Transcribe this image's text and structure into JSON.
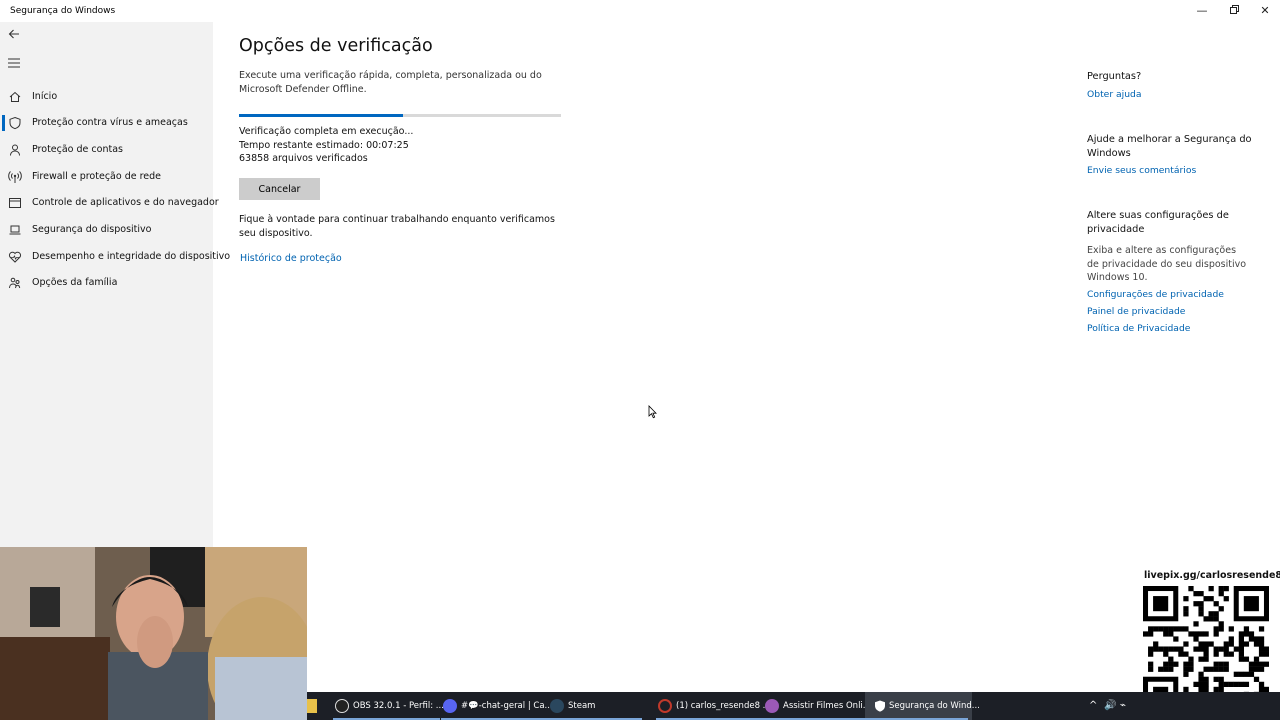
{
  "window": {
    "title": "Segurança do Windows"
  },
  "sidebar": {
    "items": [
      {
        "label": "Início",
        "icon": "home-icon"
      },
      {
        "label": "Proteção contra vírus e ameaças",
        "icon": "shield-icon"
      },
      {
        "label": "Proteção de contas",
        "icon": "person-icon"
      },
      {
        "label": "Firewall e proteção de rede",
        "icon": "antenna-icon"
      },
      {
        "label": "Controle de aplicativos e do navegador",
        "icon": "app-window-icon"
      },
      {
        "label": "Segurança do dispositivo",
        "icon": "laptop-icon"
      },
      {
        "label": "Desempenho e integridade do dispositivo",
        "icon": "heart-icon"
      },
      {
        "label": "Opções da família",
        "icon": "family-icon"
      }
    ]
  },
  "main": {
    "title": "Opções de verificação",
    "description": "Execute uma verificação rápida, completa, personalizada ou do Microsoft Defender Offline.",
    "progress_fraction": 0.51,
    "status_line1": "Verificação completa em execução...",
    "status_line2": "Tempo restante estimado: 00:07:25",
    "status_line3": "63858  arquivos verificados",
    "cancel_label": "Cancelar",
    "info_text": "Fique à vontade para continuar trabalhando enquanto verificamos seu dispositivo.",
    "history_link": "Histórico de proteção"
  },
  "right": {
    "questions_heading": "Perguntas?",
    "help_link": "Obter ajuda",
    "improve_heading": "Ajude a melhorar a Segurança do Windows",
    "feedback_link": "Envie seus comentários",
    "privacy_heading": "Altere suas configurações de privacidade",
    "privacy_text": "Exiba e altere as configurações de privacidade do seu dispositivo Windows 10.",
    "privacy_settings_link": "Configurações de privacidade",
    "privacy_panel_link": "Painel de privacidade",
    "privacy_policy_link": "Política de Privacidade"
  },
  "overlay": {
    "livepix": "livepix.gg/carlosresende8"
  },
  "taskbar": {
    "items": [
      {
        "label": "OBS 32.0.1 - Perfil: ...",
        "color": "#c0392b"
      },
      {
        "label": "#💬-chat-geral | Ca...",
        "color": "#5865f2"
      },
      {
        "label": "Steam",
        "color": "#1b2838"
      },
      {
        "label": "(1) carlos_resende8 ...",
        "color": "#c0392b"
      },
      {
        "label": "Assistir Filmes Onli...",
        "color": "#8e44ad"
      },
      {
        "label": "Segurança do Wind...",
        "color": "#ffffff"
      }
    ]
  },
  "colors": {
    "accent": "#0067c0",
    "link": "#0063b1",
    "sidebar_bg": "#f2f2f2",
    "taskbar_bg": "#1c1f26"
  }
}
